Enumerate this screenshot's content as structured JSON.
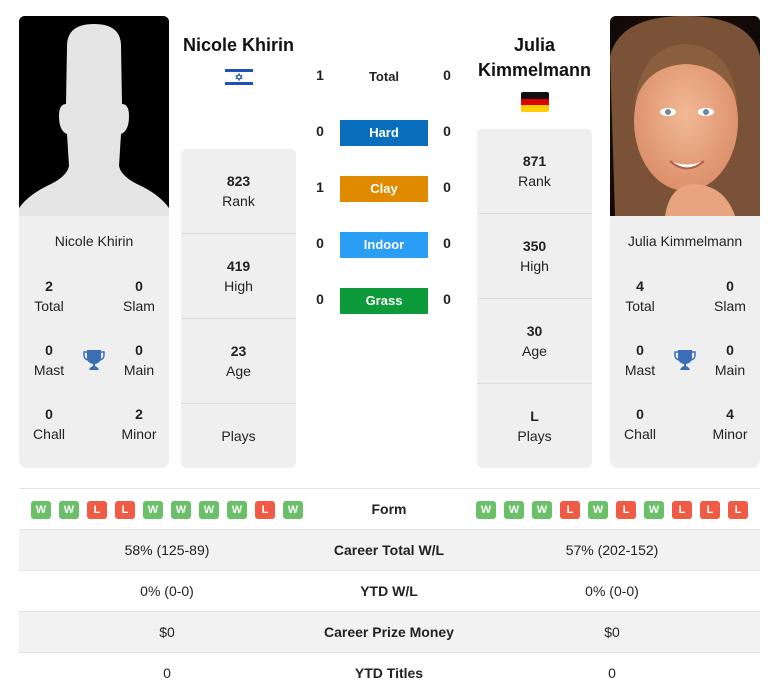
{
  "player1": {
    "name": "Nicole Khirin",
    "country": "Israel",
    "flag_icon": "israel-flag-icon",
    "photo": "silhouette-placeholder",
    "titles": {
      "total": {
        "value": "2",
        "label": "Total"
      },
      "slam": {
        "value": "0",
        "label": "Slam"
      },
      "mast": {
        "value": "0",
        "label": "Mast"
      },
      "main": {
        "value": "0",
        "label": "Main"
      },
      "chall": {
        "value": "0",
        "label": "Chall"
      },
      "minor": {
        "value": "2",
        "label": "Minor"
      }
    },
    "stats": [
      {
        "value": "823",
        "label": "Rank"
      },
      {
        "value": "419",
        "label": "High"
      },
      {
        "value": "23",
        "label": "Age"
      },
      {
        "value": "",
        "label": "Plays"
      }
    ],
    "form": [
      "W",
      "W",
      "L",
      "L",
      "W",
      "W",
      "W",
      "W",
      "L",
      "W"
    ]
  },
  "player2": {
    "name": "Julia Kimmelmann",
    "name_line1": "Julia",
    "name_line2": "Kimmelmann",
    "country": "Germany",
    "flag_icon": "germany-flag-icon",
    "photo": "player-portrait",
    "titles": {
      "total": {
        "value": "4",
        "label": "Total"
      },
      "slam": {
        "value": "0",
        "label": "Slam"
      },
      "mast": {
        "value": "0",
        "label": "Mast"
      },
      "main": {
        "value": "0",
        "label": "Main"
      },
      "chall": {
        "value": "0",
        "label": "Chall"
      },
      "minor": {
        "value": "4",
        "label": "Minor"
      }
    },
    "stats": [
      {
        "value": "871",
        "label": "Rank"
      },
      {
        "value": "350",
        "label": "High"
      },
      {
        "value": "30",
        "label": "Age"
      },
      {
        "value": "L",
        "label": "Plays"
      }
    ],
    "form": [
      "W",
      "W",
      "W",
      "L",
      "W",
      "L",
      "W",
      "L",
      "L",
      "L"
    ]
  },
  "h2h": {
    "total": {
      "label": "Total",
      "p1": "1",
      "p2": "0"
    },
    "surfaces": [
      {
        "label": "Hard",
        "p1": "0",
        "p2": "0",
        "color": "#0a6ebd"
      },
      {
        "label": "Clay",
        "p1": "1",
        "p2": "0",
        "color": "#e08a00"
      },
      {
        "label": "Indoor",
        "p1": "0",
        "p2": "0",
        "color": "#2a9df4"
      },
      {
        "label": "Grass",
        "p1": "0",
        "p2": "0",
        "color": "#0c9a3a"
      }
    ]
  },
  "form_label": "Form",
  "comparison": [
    {
      "label": "Career Total W/L",
      "p1": "58% (125-89)",
      "p2": "57% (202-152)"
    },
    {
      "label": "YTD W/L",
      "p1": "0% (0-0)",
      "p2": "0% (0-0)"
    },
    {
      "label": "Career Prize Money",
      "p1": "$0",
      "p2": "$0"
    },
    {
      "label": "YTD Titles",
      "p1": "0",
      "p2": "0"
    }
  ],
  "colors": {
    "win": "#6abf69",
    "loss": "#ef5b45",
    "trophy": "#3a6fb8",
    "card_bg": "#efefef"
  }
}
